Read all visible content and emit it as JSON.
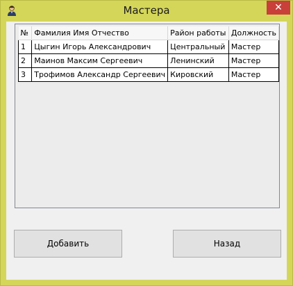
{
  "window": {
    "title": "Мастера",
    "close_glyph": "✕",
    "icon": "worker-avatar-icon"
  },
  "grid": {
    "columns": [
      "№",
      "Фамилия Имя Отчество",
      "Район работы",
      "Должность"
    ],
    "rows": [
      [
        "1",
        "Цыгин Игорь Александрович",
        "Центральный",
        "Мастер"
      ],
      [
        "2",
        "Маинов Максим Сергеевич",
        "Ленинский",
        "Мастер"
      ],
      [
        "3",
        "Трофимов Александр Сергеевич",
        "Кировский",
        "Мастер"
      ]
    ]
  },
  "buttons": {
    "add_label": "Добавить",
    "back_label": "Назад"
  },
  "colors": {
    "window_border": "#d4d65a",
    "close_button": "#c9403a"
  }
}
